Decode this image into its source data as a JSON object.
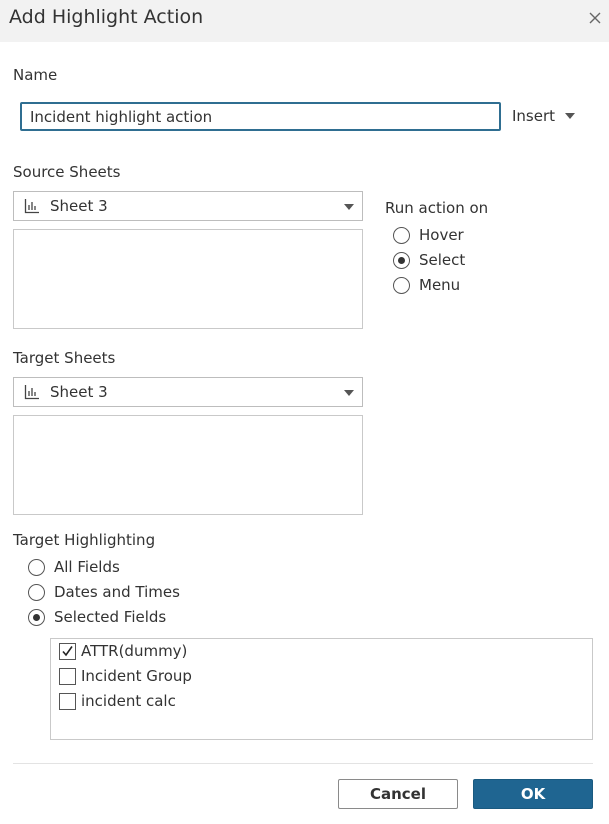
{
  "dialog": {
    "title": "Add Highlight Action",
    "close_icon": "close-icon"
  },
  "name": {
    "label": "Name",
    "value": "Incident highlight action",
    "insert_label": "Insert"
  },
  "source": {
    "label": "Source Sheets",
    "selected": "Sheet 3",
    "sheet_icon": "bar-chart-icon"
  },
  "run_action": {
    "label": "Run action on",
    "options": [
      "Hover",
      "Select",
      "Menu"
    ],
    "selected": "Select"
  },
  "target": {
    "label": "Target Sheets",
    "selected": "Sheet 3",
    "sheet_icon": "bar-chart-icon"
  },
  "highlighting": {
    "label": "Target Highlighting",
    "options": [
      "All Fields",
      "Dates and Times",
      "Selected Fields"
    ],
    "selected": "Selected Fields",
    "fields": [
      {
        "label": "ATTR(dummy)",
        "checked": true
      },
      {
        "label": "Incident Group",
        "checked": false
      },
      {
        "label": "incident calc",
        "checked": false
      }
    ]
  },
  "buttons": {
    "cancel": "Cancel",
    "ok": "OK"
  },
  "colors": {
    "accent": "#1f6591",
    "focus_border": "#2f6e91",
    "titlebar": "#f2f2f2"
  }
}
